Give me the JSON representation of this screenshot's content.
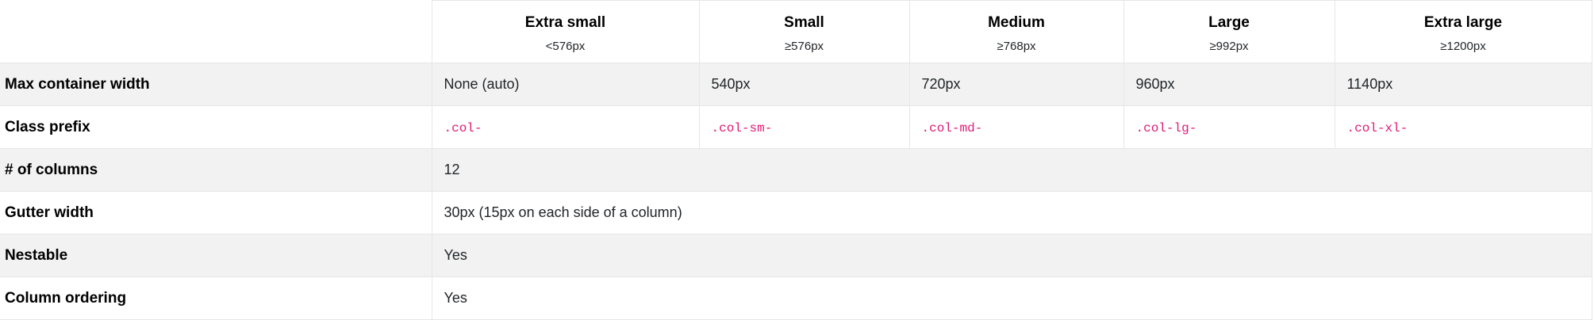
{
  "columns": [
    {
      "name": "Extra small",
      "size": "<576px"
    },
    {
      "name": "Small",
      "size": "≥576px"
    },
    {
      "name": "Medium",
      "size": "≥768px"
    },
    {
      "name": "Large",
      "size": "≥992px"
    },
    {
      "name": "Extra large",
      "size": "≥1200px"
    }
  ],
  "rows": {
    "max_container_width": {
      "label": "Max container width",
      "values": [
        "None (auto)",
        "540px",
        "720px",
        "960px",
        "1140px"
      ]
    },
    "class_prefix": {
      "label": "Class prefix",
      "values": [
        ".col-",
        ".col-sm-",
        ".col-md-",
        ".col-lg-",
        ".col-xl-"
      ]
    },
    "num_columns": {
      "label": "# of columns",
      "value": "12"
    },
    "gutter_width": {
      "label": "Gutter width",
      "value": "30px (15px on each side of a column)"
    },
    "nestable": {
      "label": "Nestable",
      "value": "Yes"
    },
    "column_ordering": {
      "label": "Column ordering",
      "value": "Yes"
    }
  },
  "colors": {
    "code_text": "#e01a76",
    "stripe": "#f2f2f2",
    "border": "#e6e6e6"
  }
}
